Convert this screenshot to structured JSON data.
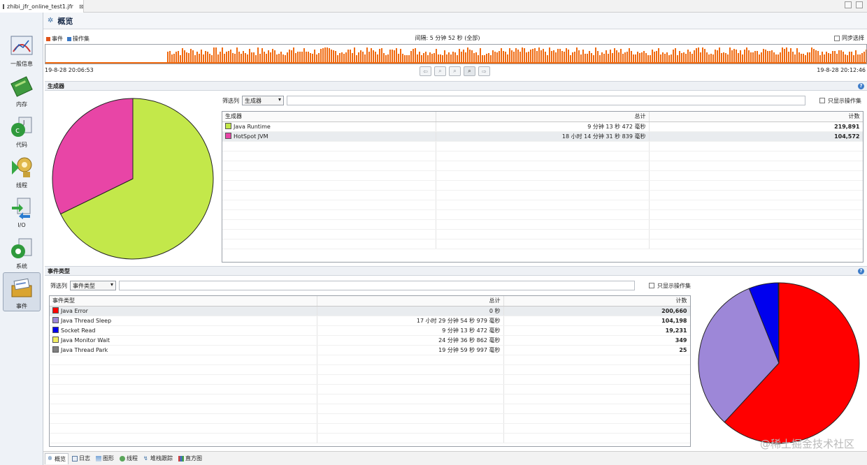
{
  "editor_tab": {
    "title": "zhibi_jfr_online_test1.jfr",
    "close": "⊠"
  },
  "sidebar": {
    "items": [
      {
        "label": "一般信息",
        "icon": "gauge-icon"
      },
      {
        "label": "内存",
        "icon": "memory-chip-icon"
      },
      {
        "label": "代码",
        "icon": "code-icon"
      },
      {
        "label": "线程",
        "icon": "threads-gear-icon"
      },
      {
        "label": "I/O",
        "icon": "io-icon"
      },
      {
        "label": "系统",
        "icon": "system-icon"
      },
      {
        "label": "事件",
        "icon": "events-icon"
      }
    ]
  },
  "overview": {
    "title": "概览",
    "icon": "gear-icon"
  },
  "timeline": {
    "legend_events": "事件",
    "legend_opset": "操作集",
    "range_label": "间隔: 5 分钟 52 秒 (全部)",
    "sync_label": "同步选择",
    "start": "19-8-28 20:06:53",
    "end": "19-8-28 20:12:46",
    "bar_color": "#f06a10"
  },
  "producers": {
    "section_title": "生成器",
    "filter_label": "筛选列",
    "filter_value": "生成器",
    "only_opset_label": "只显示操作集",
    "columns": [
      "生成器",
      "总计",
      "计数"
    ],
    "rows": [
      {
        "name": "Java Runtime",
        "color": "#c3e84a",
        "total": "9 分钟 13 秒 472 毫秒",
        "count": "219,891"
      },
      {
        "name": "HotSpot JVM",
        "color": "#e845a6",
        "total": "18 小时 14 分钟 31 秒 839 毫秒",
        "count": "104,572"
      }
    ]
  },
  "event_types": {
    "section_title": "事件类型",
    "filter_label": "筛选列",
    "filter_value": "事件类型",
    "only_opset_label": "只显示操作集",
    "columns": [
      "事件类型",
      "总计",
      "计数"
    ],
    "rows": [
      {
        "name": "Java Error",
        "color": "#ff0000",
        "total": "0 秒",
        "count": "200,660"
      },
      {
        "name": "Java Thread Sleep",
        "color": "#9d87d8",
        "total": "17 小时 29 分钟 54 秒 979 毫秒",
        "count": "104,198"
      },
      {
        "name": "Socket Read",
        "color": "#0000ee",
        "total": "9 分钟 13 秒 472 毫秒",
        "count": "19,231"
      },
      {
        "name": "Java Monitor Wait",
        "color": "#f2ee60",
        "total": "24 分钟 36 秒 862 毫秒",
        "count": "349"
      },
      {
        "name": "Java Thread Park",
        "color": "#808080",
        "total": "19 分钟 59 秒 997 毫秒",
        "count": "25"
      }
    ]
  },
  "bottom_tabs": [
    "概览",
    "日志",
    "图形",
    "线程",
    "堆栈跟踪",
    "直方图"
  ],
  "watermark": "@稀土掘金技术社区"
}
